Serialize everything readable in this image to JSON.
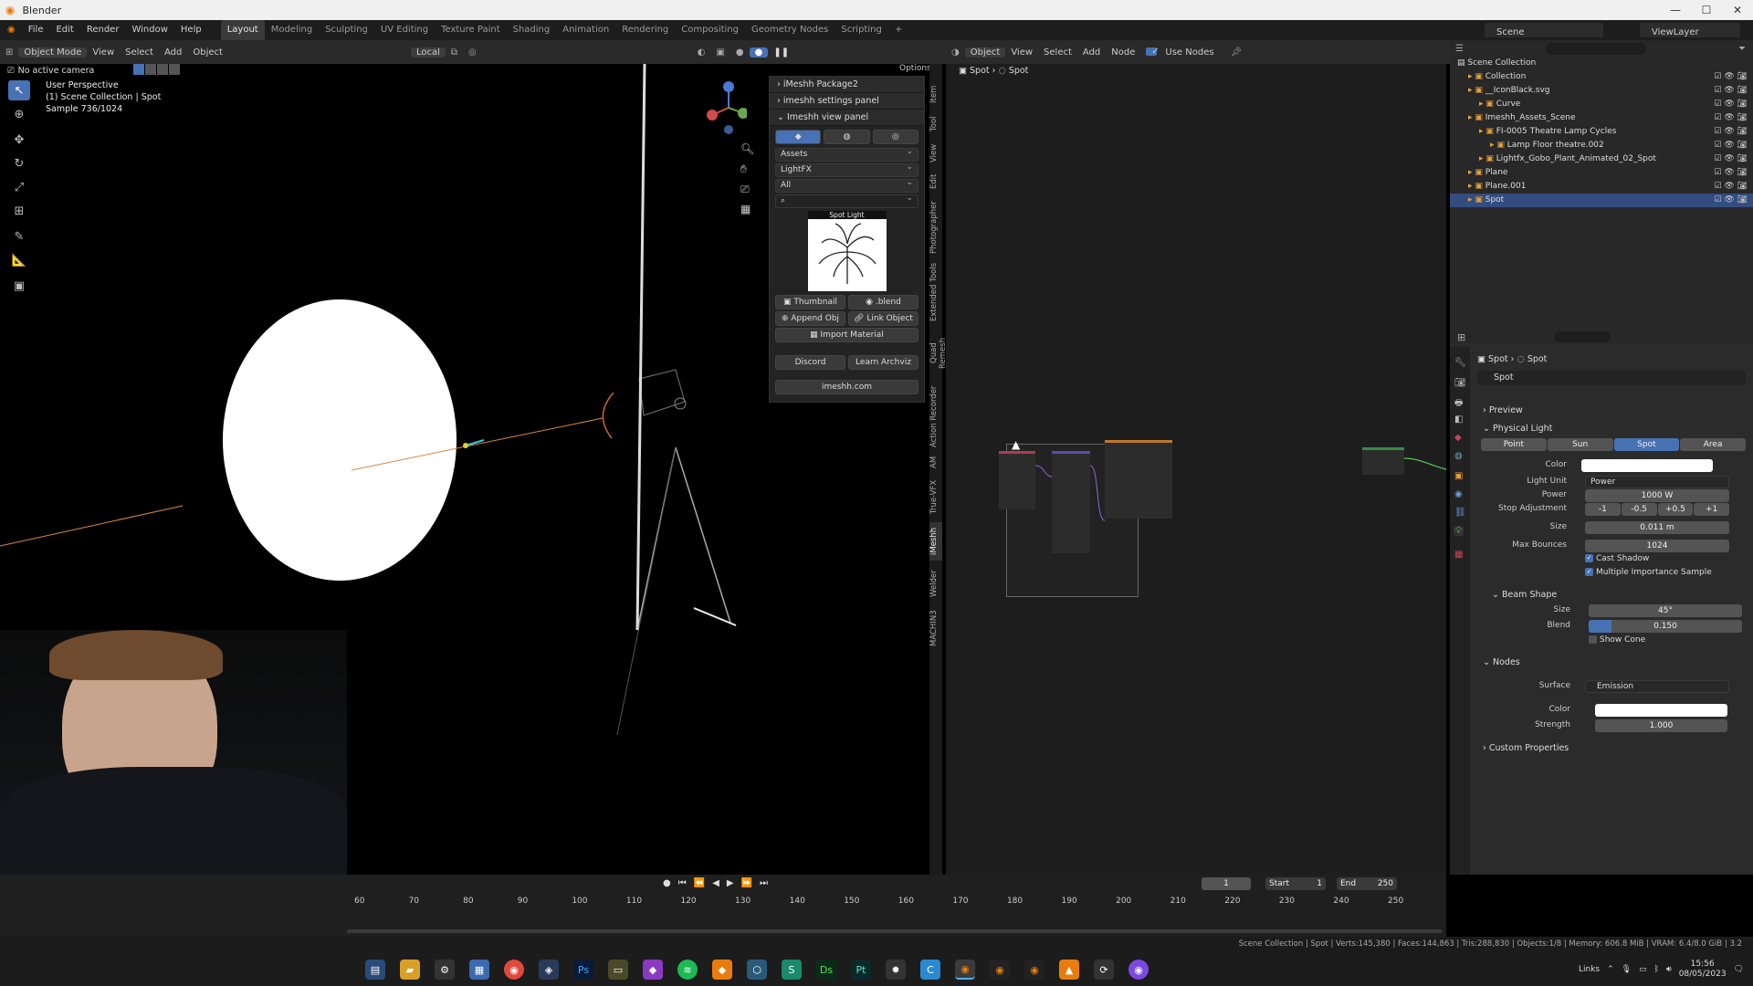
{
  "window": {
    "title": "Blender"
  },
  "menu": [
    "File",
    "Edit",
    "Render",
    "Window",
    "Help"
  ],
  "workspaces": [
    "Layout",
    "Modeling",
    "Sculpting",
    "UV Editing",
    "Texture Paint",
    "Shading",
    "Animation",
    "Rendering",
    "Compositing",
    "Geometry Nodes",
    "Scripting"
  ],
  "active_workspace": "Layout",
  "scene": {
    "name": "Scene",
    "view_layer": "ViewLayer"
  },
  "viewport": {
    "mode": "Object Mode",
    "menu": [
      "View",
      "Select",
      "Add",
      "Object"
    ],
    "pivot": "Local",
    "options_label": "Options",
    "camera_label": "No active camera",
    "info_line1": "User Perspective",
    "info_line2": "(1) Scene Collection | Spot",
    "info_line3": "Sample 736/1024"
  },
  "imeshh": {
    "package_title": "iMeshh Package2",
    "settings_title": "imeshh settings panel",
    "view_title": "Imeshh view panel",
    "assets_select": "Assets",
    "category_select": "LightFX",
    "filter_select": "All",
    "preview_label": "Spot Light",
    "thumbnail_btn": "Thumbnail",
    "blend_btn": ".blend",
    "append_btn": "Append Obj",
    "link_btn": "Link Object",
    "import_btn": "Import Material",
    "discord_btn": "Discord",
    "archviz_btn": "Learn Archviz",
    "site_btn": "imeshh.com"
  },
  "sidetabs": [
    "Item",
    "Tool",
    "View",
    "Edit",
    "Photographer",
    "Extended Tools",
    "Quad Remesh",
    "Action Recorder",
    "AM",
    "True-VFX",
    "iMeshh",
    "Welder",
    "MACHIN3"
  ],
  "node_editor": {
    "object_label": "Object",
    "menu": [
      "View",
      "Select",
      "Add",
      "Node"
    ],
    "use_nodes": "Use Nodes",
    "crumb1": "Spot",
    "crumb2": "Spot"
  },
  "outliner": {
    "rows": [
      {
        "label": "Scene Collection",
        "depth": 0
      },
      {
        "label": "Collection",
        "depth": 1
      },
      {
        "label": "__IconBlack.svg",
        "depth": 1
      },
      {
        "label": "Curve",
        "depth": 2
      },
      {
        "label": "Imeshh_Assets_Scene",
        "depth": 1
      },
      {
        "label": "FI-0005 Theatre Lamp Cycles",
        "depth": 2
      },
      {
        "label": "Lamp Floor theatre.002",
        "depth": 3
      },
      {
        "label": "Lightfx_Gobo_Plant_Animated_02_Spot",
        "depth": 2
      },
      {
        "label": "Plane",
        "depth": 1
      },
      {
        "label": "Plane.001",
        "depth": 1
      },
      {
        "label": "Spot",
        "depth": 1
      }
    ]
  },
  "properties": {
    "crumb1": "Spot",
    "crumb2": "Spot",
    "data_name": "Spot",
    "preview": "Preview",
    "physical_light": "Physical Light",
    "light_types": [
      "Point",
      "Sun",
      "Spot",
      "Area"
    ],
    "active_type": "Spot",
    "color_label": "Color",
    "light_unit_label": "Light Unit",
    "light_unit": "Power",
    "power_label": "Power",
    "power": "1000 W",
    "stop_label": "Stop Adjustment",
    "stops": [
      "-1",
      "-0.5",
      "+0.5",
      "+1"
    ],
    "size_label": "Size",
    "size": "0.011 m",
    "bounces_label": "Max Bounces",
    "bounces": "1024",
    "cast_shadow": "Cast Shadow",
    "mis": "Multiple Importance Sample",
    "beam_shape": "Beam Shape",
    "beam_size_label": "Size",
    "beam_size": "45°",
    "blend_label": "Blend",
    "blend": "0.150",
    "blend_fraction": 0.15,
    "show_cone": "Show Cone",
    "nodes": "Nodes",
    "surface_label": "Surface",
    "surface": "Emission",
    "ncolor_label": "Color",
    "strength_label": "Strength",
    "strength": "1.000",
    "custom_props": "Custom Properties"
  },
  "timeline": {
    "current_frame": "1",
    "start_label": "Start",
    "start": "1",
    "end_label": "End",
    "end": "250",
    "ticks": [
      "60",
      "70",
      "80",
      "90",
      "100",
      "110",
      "120",
      "130",
      "140",
      "150",
      "160",
      "170",
      "180",
      "190",
      "200",
      "210",
      "220",
      "230",
      "240",
      "250"
    ]
  },
  "status": {
    "text": "Scene Collection | Spot | Verts:145,380 | Faces:144,863 | Tris:288,830 | Objects:1/8 | Memory: 606.8 MiB | VRAM: 6.4/8.0 GiB | 3.2"
  },
  "taskbar": {
    "links": "Links",
    "time": "15:56",
    "date": "08/05/2023"
  },
  "colors": {
    "accent": "#4772b3",
    "bg": "#1d1d1d",
    "panel": "#2b2b2b",
    "active_row": "#334d80"
  }
}
